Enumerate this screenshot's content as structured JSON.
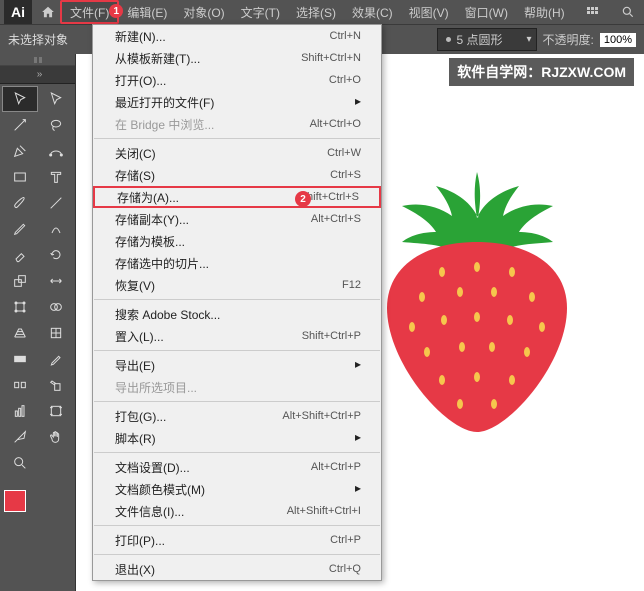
{
  "menubar": {
    "logo": "Ai",
    "items": [
      "文件(F)",
      "编辑(E)",
      "对象(O)",
      "文字(T)",
      "选择(S)",
      "效果(C)",
      "视图(V)",
      "窗口(W)",
      "帮助(H)"
    ]
  },
  "badge1": "1",
  "optbar": {
    "selection": "未选择对象",
    "stroke_style": "5 点圆形",
    "opacity_label": "不透明度:",
    "opacity_value": "100%"
  },
  "watermark": "软件自学网：RJZXW.COM",
  "menu": {
    "items": [
      {
        "label": "新建(N)...",
        "kbd": "Ctrl+N"
      },
      {
        "label": "从模板新建(T)...",
        "kbd": "Shift+Ctrl+N"
      },
      {
        "label": "打开(O)...",
        "kbd": "Ctrl+O"
      },
      {
        "label": "最近打开的文件(F)",
        "sub": true
      },
      {
        "label": "在 Bridge 中浏览...",
        "kbd": "Alt+Ctrl+O",
        "disabled": true
      },
      {
        "sep": true
      },
      {
        "label": "关闭(C)",
        "kbd": "Ctrl+W"
      },
      {
        "label": "存储(S)",
        "kbd": "Ctrl+S"
      },
      {
        "label": "存储为(A)...",
        "kbd": "Shift+Ctrl+S",
        "hl": true,
        "badge": "2"
      },
      {
        "label": "存储副本(Y)...",
        "kbd": "Alt+Ctrl+S"
      },
      {
        "label": "存储为模板..."
      },
      {
        "label": "存储选中的切片..."
      },
      {
        "label": "恢复(V)",
        "kbd": "F12"
      },
      {
        "sep": true
      },
      {
        "label": "搜索 Adobe Stock..."
      },
      {
        "label": "置入(L)...",
        "kbd": "Shift+Ctrl+P"
      },
      {
        "sep": true
      },
      {
        "label": "导出(E)",
        "sub": true
      },
      {
        "label": "导出所选项目...",
        "disabled": true
      },
      {
        "sep": true
      },
      {
        "label": "打包(G)...",
        "kbd": "Alt+Shift+Ctrl+P"
      },
      {
        "label": "脚本(R)",
        "sub": true
      },
      {
        "sep": true
      },
      {
        "label": "文档设置(D)...",
        "kbd": "Alt+Ctrl+P"
      },
      {
        "label": "文档颜色模式(M)",
        "sub": true
      },
      {
        "label": "文件信息(I)...",
        "kbd": "Alt+Shift+Ctrl+I"
      },
      {
        "sep": true
      },
      {
        "label": "打印(P)...",
        "kbd": "Ctrl+P"
      },
      {
        "sep": true
      },
      {
        "label": "退出(X)",
        "kbd": "Ctrl+Q"
      }
    ]
  }
}
